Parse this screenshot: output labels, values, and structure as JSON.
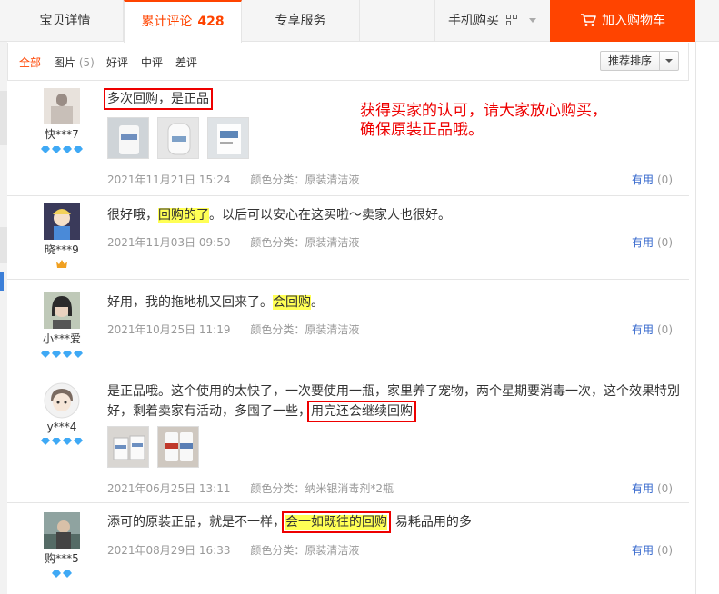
{
  "tabs": {
    "detail": "宝贝详情",
    "reviews": "累计评论",
    "reviews_count": "428",
    "service": "专享服务",
    "mobile_buy": "手机购买",
    "add_to_cart": "加入购物车"
  },
  "filters": {
    "all": "全部",
    "photos": "图片",
    "photos_count": "(5)",
    "good": "好评",
    "medium": "中评",
    "bad": "差评",
    "sort": "推荐排序"
  },
  "annotation": {
    "line1": "获得买家的认可，请大家放心购买，",
    "line2": "确保原装正品哦。"
  },
  "reviews": [
    {
      "nick": "快***7",
      "level": "diamond-4",
      "text": "多次回购，是正品",
      "date": "2021年11月21日 15:24",
      "spec": "颜色分类：原装清洁液",
      "useful": "有用",
      "useful_count": "(0)"
    },
    {
      "nick": "晓***9",
      "level": "crown-1",
      "text_a": "很好哦，",
      "text_hl": "回购的了",
      "text_b": "。以后可以安心在这买啦～卖家人也很好。",
      "date": "2021年11月03日 09:50",
      "spec": "颜色分类：原装清洁液",
      "useful": "有用",
      "useful_count": "(0)"
    },
    {
      "nick": "小***爱",
      "level": "diamond-4",
      "text_a": "好用，我的拖地机又回来了。",
      "text_hl": "会回购",
      "text_b": "。",
      "date": "2021年10月25日 11:19",
      "spec": "颜色分类：原装清洁液",
      "useful": "有用",
      "useful_count": "(0)"
    },
    {
      "nick": "y***4",
      "level": "diamond-4",
      "text_a": "是正品哦。这个使用的太快了，一次要使用一瓶，家里养了宠物，两个星期要消毒一次，这个效果特别好，剩着卖家有活动，多囤了一些，",
      "text_boxed": "用完还会继续回购",
      "date": "2021年06月25日 13:11",
      "spec": "颜色分类：纳米银消毒剂*2瓶",
      "useful": "有用",
      "useful_count": "(0)"
    },
    {
      "nick": "购***5",
      "level": "diamond-2",
      "text_a": "添可的原装正品，就是不一样，",
      "text_hl": "会一如既往的回购",
      "text_b": "  易耗品用的多",
      "date": "2021年08月29日 16:33",
      "spec": "颜色分类：原装清洁液",
      "useful": "有用",
      "useful_count": "(0)"
    }
  ],
  "colors": {
    "accent": "#ff4400",
    "annotation_red": "#ee0000",
    "highlight": "#ffff55",
    "link_blue": "#3366cc"
  }
}
